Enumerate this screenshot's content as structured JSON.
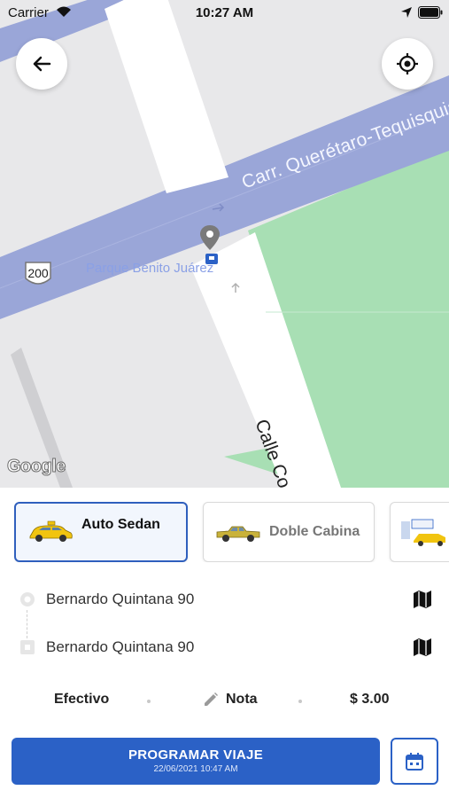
{
  "status_bar": {
    "carrier": "Carrier",
    "time": "10:27 AM"
  },
  "map": {
    "road_label": "Carr. Querétaro-Tequisquiapan",
    "poi_label": "Parque Benito Juárez",
    "street_label": "Calle Co",
    "route_shield": "200",
    "attribution": "Google",
    "colors": {
      "road": "#9aa6d8",
      "park": "#a8dfb4",
      "land": "#e8e8ea",
      "street": "#ffffff"
    }
  },
  "vehicles": [
    {
      "label": "Auto Sedan",
      "selected": true
    },
    {
      "label": "Doble Cabina",
      "selected": false
    },
    {
      "label": "",
      "selected": false
    }
  ],
  "route": {
    "origin": "Bernardo Quintana 90",
    "destination": "Bernardo Quintana 90"
  },
  "options": {
    "payment": "Efectivo",
    "note": "Nota",
    "price": "$ 3.00"
  },
  "cta": {
    "label": "PROGRAMAR VIAJE",
    "datetime": "22/06/2021 10:47 AM"
  },
  "colors": {
    "primary": "#2b61c6"
  }
}
